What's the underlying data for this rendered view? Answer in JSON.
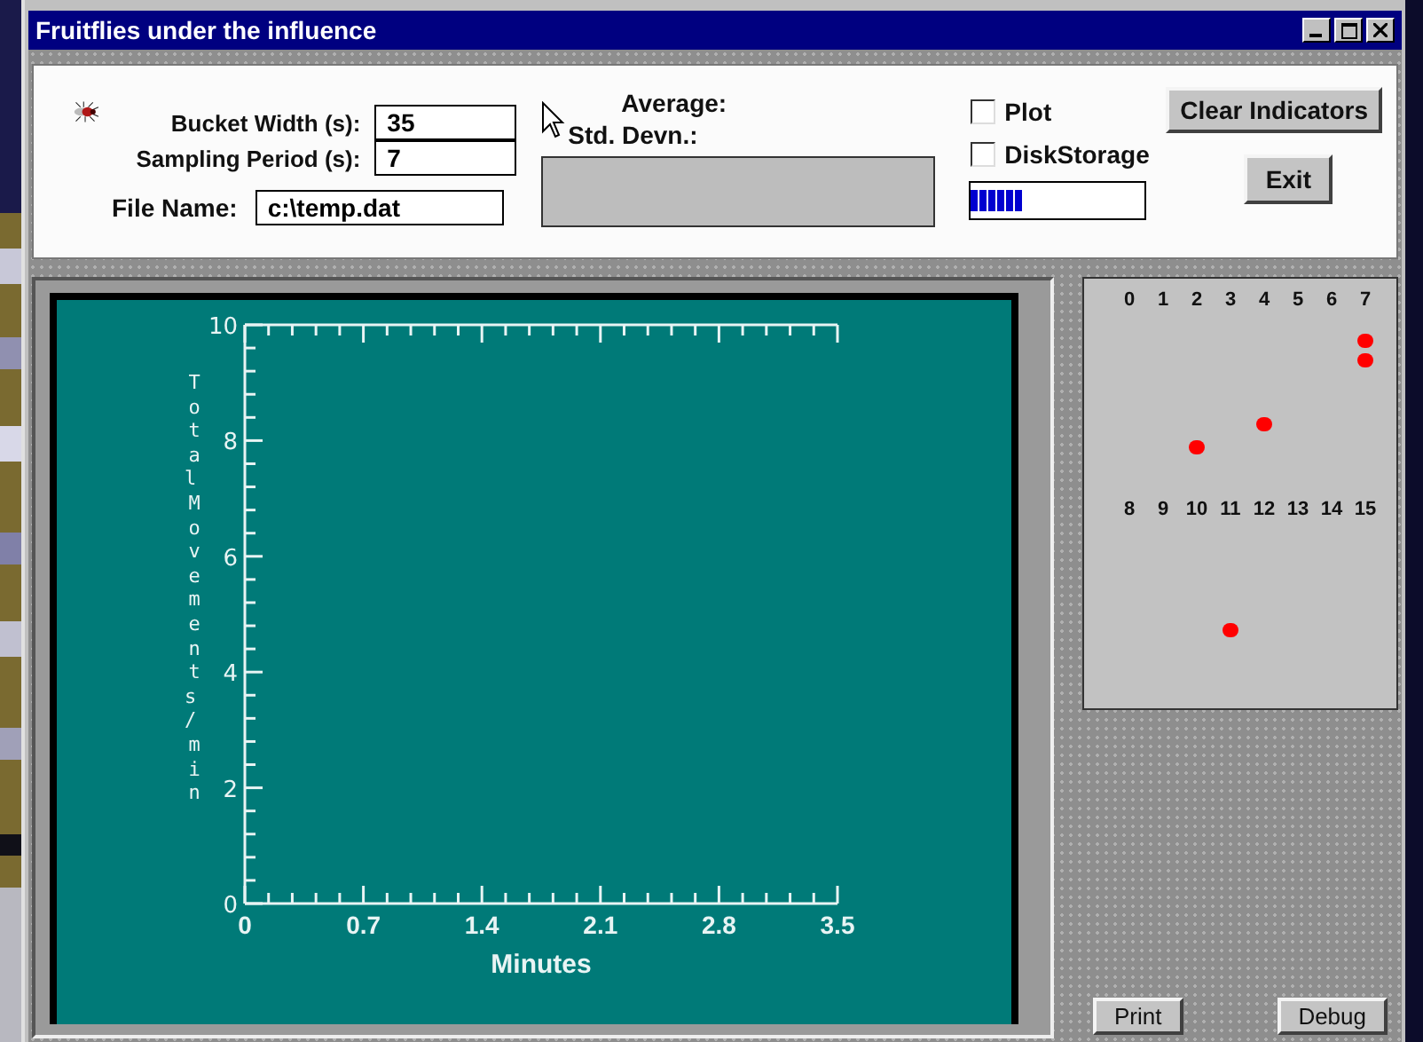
{
  "window": {
    "title": "Fruitflies under the influence"
  },
  "settings": {
    "bucket_width": {
      "label": "Bucket Width (s):",
      "value": "35"
    },
    "sampling_period": {
      "label": "Sampling Period (s):",
      "value": "7"
    },
    "file_name": {
      "label": "File Name:",
      "value": "c:\\temp.dat"
    }
  },
  "stats": {
    "average_label": "Average:",
    "std_label": "Std. Devn.:"
  },
  "options": [
    {
      "label": "Plot",
      "checked": false
    },
    {
      "label": "DiskStorage",
      "checked": false
    }
  ],
  "buttons": {
    "clear": "Clear Indicators",
    "exit": "Exit",
    "print": "Print",
    "debug": "Debug"
  },
  "chart": {
    "chart_data": {
      "type": "line",
      "xlabel": "Minutes",
      "ylabel": "Total Movements / min",
      "xlim": [
        0,
        3.5
      ],
      "ylim": [
        0,
        10
      ],
      "xticks": [
        0,
        0.7,
        1.4,
        2.1,
        2.8,
        3.5
      ],
      "yticks": [
        0,
        2,
        4,
        6,
        8,
        10
      ]
    }
  },
  "channels": [
    {
      "label": "0",
      "active": false
    },
    {
      "label": "1",
      "active": false
    },
    {
      "label": "2",
      "active": true
    },
    {
      "label": "3",
      "active": false
    },
    {
      "label": "4",
      "active": true
    },
    {
      "label": "5",
      "active": false
    },
    {
      "label": "6",
      "active": false
    },
    {
      "label": "7",
      "active": true
    },
    {
      "label": "8",
      "active": false
    },
    {
      "label": "9",
      "active": false
    },
    {
      "label": "10",
      "active": false
    },
    {
      "label": "11",
      "active": true
    },
    {
      "label": "12",
      "active": false
    },
    {
      "label": "13",
      "active": false
    },
    {
      "label": "14",
      "active": false
    },
    {
      "label": "15",
      "active": false
    }
  ]
}
